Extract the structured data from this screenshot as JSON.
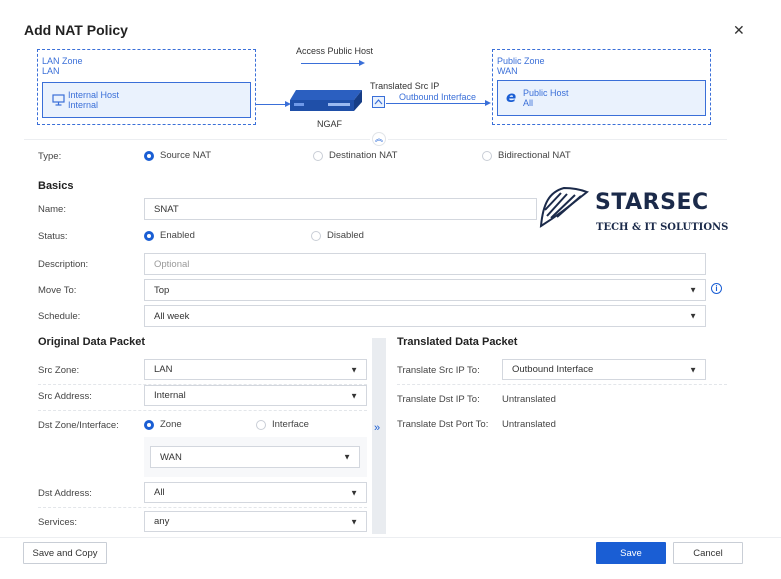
{
  "dialog": {
    "title": "Add NAT Policy"
  },
  "diagram": {
    "lan_zone_title": "LAN Zone",
    "lan_zone_name": "LAN",
    "internal_host_title": "Internal Host",
    "internal_host_value": "Internal",
    "access_public_host": "Access Public Host",
    "translated_src_ip": "Translated Src IP",
    "outbound_interface": "Outbound Interface",
    "device_name": "NGAF",
    "public_zone_title": "Public Zone",
    "public_zone_name": "WAN",
    "public_host_title": "Public Host",
    "public_host_value": "All"
  },
  "type": {
    "label": "Type:",
    "options": [
      "Source NAT",
      "Destination NAT",
      "Bidirectional NAT"
    ],
    "selected": "Source NAT"
  },
  "basics": {
    "heading": "Basics",
    "name_label": "Name:",
    "name_value": "SNAT",
    "status_label": "Status:",
    "status_enabled": "Enabled",
    "status_disabled": "Disabled",
    "description_label": "Description:",
    "description_placeholder": "Optional",
    "move_to_label": "Move To:",
    "move_to_value": "Top",
    "schedule_label": "Schedule:",
    "schedule_value": "All week"
  },
  "watermark": {
    "brand": "STARSEC",
    "tagline": "TECH & IT SOLUTIONS"
  },
  "original": {
    "heading": "Original Data Packet",
    "src_zone_label": "Src Zone:",
    "src_zone_value": "LAN",
    "src_address_label": "Src Address:",
    "src_address_value": "Internal",
    "dst_zone_label": "Dst Zone/Interface:",
    "dst_zone_option": "Zone",
    "dst_interface_option": "Interface",
    "dst_zone_value": "WAN",
    "dst_address_label": "Dst Address:",
    "dst_address_value": "All",
    "services_label": "Services:",
    "services_value": "any"
  },
  "translated": {
    "heading": "Translated Data Packet",
    "src_ip_label": "Translate Src IP To:",
    "src_ip_value": "Outbound Interface",
    "dst_ip_label": "Translate Dst IP To:",
    "dst_ip_value": "Untranslated",
    "dst_port_label": "Translate Dst Port To:",
    "dst_port_value": "Untranslated"
  },
  "footer": {
    "save_copy": "Save and Copy",
    "save": "Save",
    "cancel": "Cancel"
  },
  "colors": {
    "accent": "#1a5ed4",
    "diagram_blue": "#3a6fd8",
    "brand_navy": "#1b2a4a"
  }
}
